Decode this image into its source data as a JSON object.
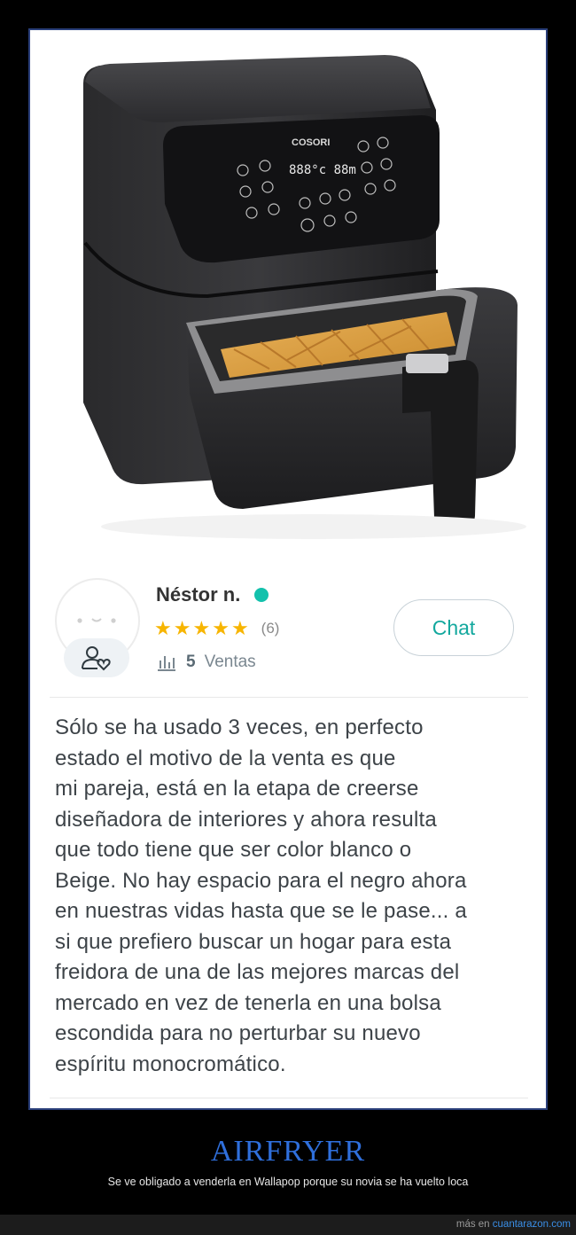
{
  "product": {
    "brand": "COSORI"
  },
  "seller": {
    "name": "Néstor n.",
    "status_color": "#13c1ac",
    "rating": {
      "stars": 5,
      "max": 5,
      "count": "(6)"
    },
    "sales": {
      "count": "5",
      "label": "Ventas"
    }
  },
  "actions": {
    "chat_label": "Chat"
  },
  "description": "Sólo se ha usado 3 veces, en perfecto\nestado el motivo de la venta es que\nmi pareja, está en la etapa de creerse\ndiseñadora de interiores y ahora resulta\nque todo tiene que ser color blanco o\nBeige. No hay espacio para el negro ahora\nen nuestras vidas hasta que se le pase... a\nsi que prefiero buscar un hogar para esta\nfreidora de una de las mejores marcas del\nmercado en vez de tenerla en una bolsa\nescondida para no perturbar su nuevo\nespíritu monocromático.",
  "caption": {
    "title": "AIRFRYER",
    "subtitle": "Se ve obligado a venderla en Wallapop porque su novia se ha vuelto loca"
  },
  "footer": {
    "prefix": "más en",
    "link": "cuantarazon.com"
  },
  "colors": {
    "accent": "#13a89e",
    "star": "#f7b500",
    "caption_title": "#2f6fdb",
    "frame_border": "#2a3f7a"
  }
}
